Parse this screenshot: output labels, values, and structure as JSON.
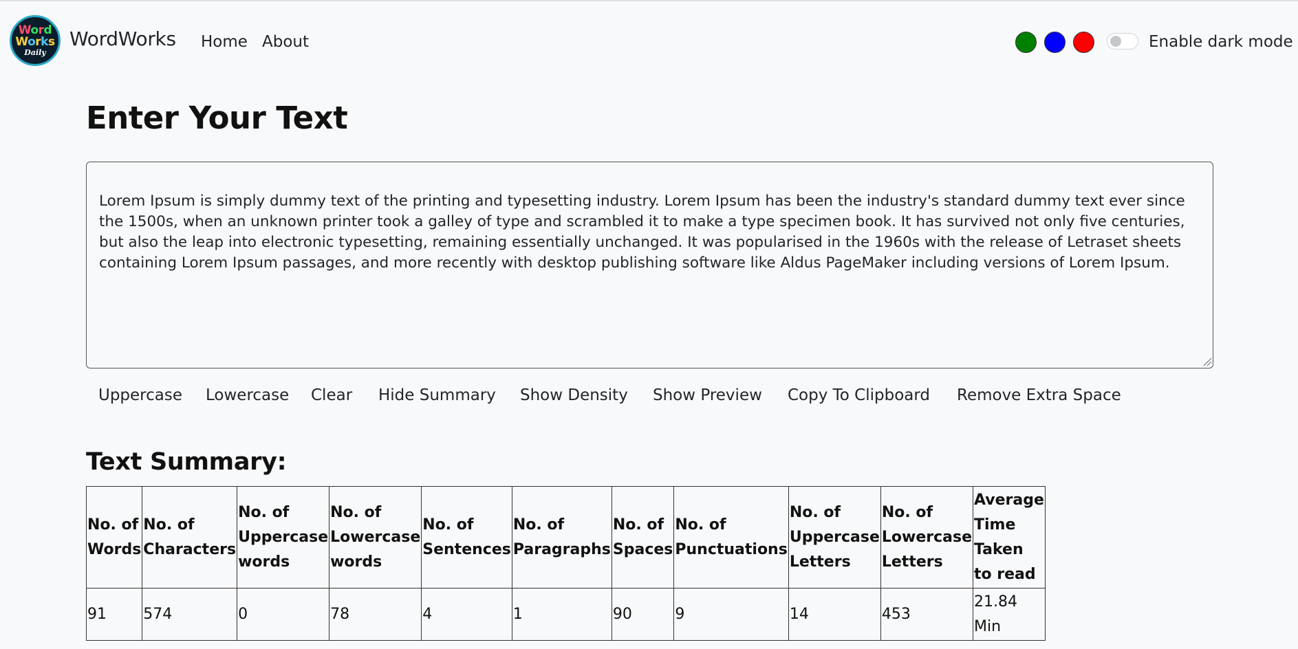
{
  "navbar": {
    "logo": {
      "line1a": "Word",
      "line2a": "Works",
      "line3": "Daily"
    },
    "brand": "WordWorks",
    "links": [
      "Home",
      "About"
    ],
    "theme_colors": [
      "#008000",
      "#0000ff",
      "#ff0000"
    ],
    "dark_mode_label": "Enable dark mode"
  },
  "main": {
    "heading": "Enter Your Text",
    "text_value": "Lorem Ipsum is simply dummy text of the printing and typesetting industry. Lorem Ipsum has been the industry's standard dummy text ever since the 1500s, when an unknown printer took a galley of type and scrambled it to make a type specimen book. It has survived not only five centuries, but also the leap into electronic typesetting, remaining essentially unchanged. It was popularised in the 1960s with the release of Letraset sheets containing Lorem Ipsum passages, and more recently with desktop publishing software like Aldus PageMaker including versions of Lorem Ipsum.",
    "buttons": [
      "Uppercase",
      "Lowercase",
      "Clear",
      "Hide Summary",
      "Show Density",
      "Show Preview",
      "Copy To Clipboard",
      "Remove Extra Space"
    ]
  },
  "summary": {
    "title": "Text Summary:",
    "headers": [
      "No. of Words",
      "No. of Characters",
      "No. of Uppercase words",
      "No. of Lowercase words",
      "No. of Sentences",
      "No. of Paragraphs",
      "No. of Spaces",
      "No. of Punctuations",
      "No. of Uppercase Letters",
      "No. of Lowercase Letters",
      "Average Time Taken to read"
    ],
    "values": [
      "91",
      "574",
      "0",
      "78",
      "4",
      "1",
      "90",
      "9",
      "14",
      "453",
      "21.84 Min"
    ]
  }
}
